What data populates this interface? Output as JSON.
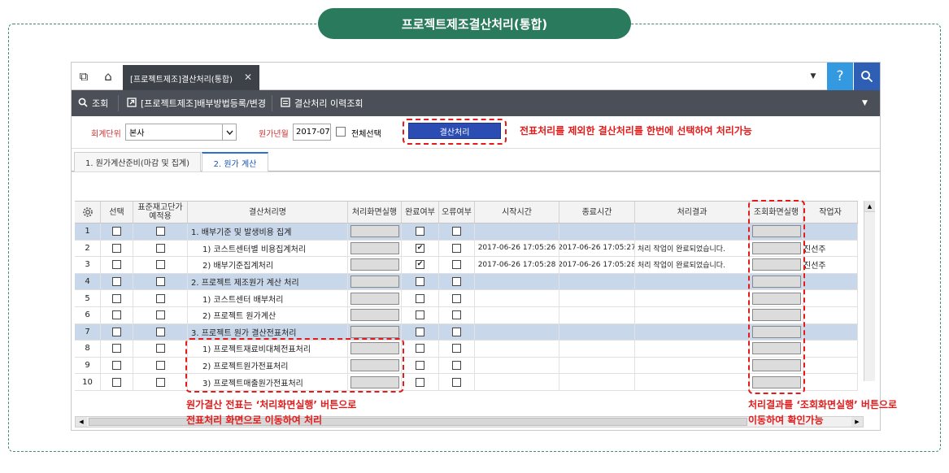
{
  "page_title": "프로젝트제조결산처리(통합)",
  "tabbar": {
    "tab_label": "[프로젝트제조]결산처리(통합)",
    "close_symbol": "✕",
    "help_symbol": "?",
    "dropdown_symbol": "▼"
  },
  "toolbar": {
    "items": [
      {
        "label": "조회",
        "icon": "search-icon"
      },
      {
        "label": "[프로젝트제조]배부방법등록/변경",
        "icon": "external-link-icon"
      },
      {
        "label": "결산처리 이력조회",
        "icon": "list-icon"
      }
    ],
    "dropdown_symbol": "▼"
  },
  "filter": {
    "unit_label": "회계단위",
    "unit_value": "본사",
    "period_label": "원가년월",
    "period_value": "2017-07",
    "select_all_label": "전체선택",
    "run_button": "결산처리"
  },
  "annotations": {
    "top_note": "전표처리를 제외한 결산처리를 한번에 선택하여 처리가능",
    "left_note_1": "원가결산 전표는 ‘처리화면실행’ 버튼으로",
    "left_note_2": "전표처리 화면으로 이동하여 처리",
    "right_note_1": "처리결과를 ‘조회화면실행’ 버튼으로",
    "right_note_2": "이동하여 확인가능"
  },
  "subtabs": [
    "1. 원가계산준비(마감 및 집계)",
    "2. 원가 계산"
  ],
  "grid": {
    "headers": [
      "선택",
      "표준재고단가\n예적용",
      "결산처리명",
      "처리화면실행",
      "완료여부",
      "오류여부",
      "시작시간",
      "종료시간",
      "처리결과",
      "조회화면실행",
      "작업자"
    ],
    "rows": [
      {
        "no": "1",
        "name": "1. 배부기준 및 발생비용 집계",
        "group": true,
        "done": false,
        "start": "",
        "end": "",
        "result": "",
        "worker": ""
      },
      {
        "no": "2",
        "name": "1) 코스트센터별 비용집계처리",
        "group": false,
        "done": true,
        "start": "2017-06-26 17:05:26",
        "end": "2017-06-26 17:05:27",
        "result": "처리 작업이 완료되었습니다.",
        "worker": "진선주"
      },
      {
        "no": "3",
        "name": "2) 배부기준집계처리",
        "group": false,
        "done": true,
        "start": "2017-06-26 17:05:28",
        "end": "2017-06-26 17:05:28",
        "result": "처리 작업이 완료되었습니다.",
        "worker": "진선주"
      },
      {
        "no": "4",
        "name": "2. 프로젝트 제조원가 계산 처리",
        "group": true,
        "done": false,
        "start": "",
        "end": "",
        "result": "",
        "worker": ""
      },
      {
        "no": "5",
        "name": "1) 코스트센터 배부처리",
        "group": false,
        "done": false,
        "start": "",
        "end": "",
        "result": "",
        "worker": ""
      },
      {
        "no": "6",
        "name": "2) 프로젝트 원가계산",
        "group": false,
        "done": false,
        "start": "",
        "end": "",
        "result": "",
        "worker": ""
      },
      {
        "no": "7",
        "name": "3. 프로젝트 원가 결산전표처리",
        "group": true,
        "done": false,
        "start": "",
        "end": "",
        "result": "",
        "worker": ""
      },
      {
        "no": "8",
        "name": "1) 프로젝트재료비대체전표처리",
        "group": false,
        "done": false,
        "start": "",
        "end": "",
        "result": "",
        "worker": ""
      },
      {
        "no": "9",
        "name": "2) 프로젝트원가전표처리",
        "group": false,
        "done": false,
        "start": "",
        "end": "",
        "result": "",
        "worker": ""
      },
      {
        "no": "10",
        "name": "3) 프로젝트매출원가전표처리",
        "group": false,
        "done": false,
        "start": "",
        "end": "",
        "result": "",
        "worker": ""
      }
    ]
  },
  "colors": {
    "accent": "#2a7a5e",
    "note_red": "#e31b1b",
    "group_row": "#c8d8ea"
  }
}
